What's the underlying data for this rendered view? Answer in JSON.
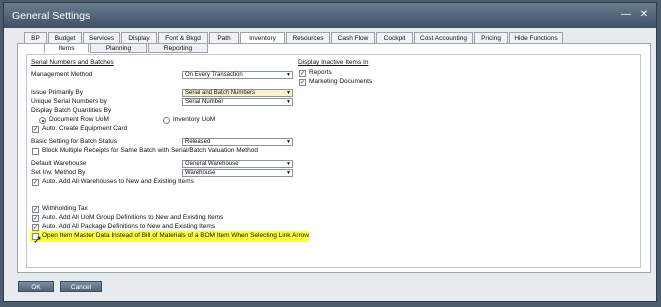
{
  "window": {
    "title": "General Settings",
    "minimize": "—",
    "close": "✕"
  },
  "tabs": [
    {
      "label": "BP"
    },
    {
      "label": "Budget"
    },
    {
      "label": "Services"
    },
    {
      "label": "Display"
    },
    {
      "label": "Font & Bkgd"
    },
    {
      "label": "Path"
    },
    {
      "label": "Inventory"
    },
    {
      "label": "Resources"
    },
    {
      "label": "Cash Flow"
    },
    {
      "label": "Cockpit"
    },
    {
      "label": "Cost Accounting"
    },
    {
      "label": "Pricing"
    },
    {
      "label": "Hide Functions"
    }
  ],
  "active_tab": "Inventory",
  "subtabs": [
    {
      "label": "Items"
    },
    {
      "label": "Planning"
    },
    {
      "label": "Reporting"
    }
  ],
  "form": {
    "serial_section": "Serial Numbers and Batches",
    "mgmt_method_label": "Management Method",
    "mgmt_method_value": "On Every Transaction",
    "issue_primarily_label": "Issue Primarily By",
    "issue_primarily_value": "Serial and Batch Numbers",
    "unique_serial_label": "Unique Serial Numbers by",
    "unique_serial_value": "Serial Number",
    "display_batch_label": "Display Batch Quantities By",
    "radio_doc_row": "Document Row UoM",
    "radio_inventory": "Inventory UoM",
    "auto_create_equipment": "Auto. Create Equipment Card",
    "basic_setting_label": "Basic Setting for Batch Status",
    "basic_setting_value": "Released",
    "block_multiple": "Block Multiple Receipts for Same Batch with Serial/Batch Valuation Method",
    "default_wh_label": "Default Warehouse",
    "default_wh_value": "General Warehouse",
    "set_inv_label": "Set Inv. Method By",
    "set_inv_value": "Warehouse",
    "auto_add_wh": "Auto. Add All Warehouses to New and Existing Items",
    "withholding_tax": "Withholding Tax",
    "auto_add_uom": "Auto. Add All UoM Group Definitions to New and Existing Items",
    "auto_add_package": "Auto. Add All Package Definitions to New and Existing Items",
    "open_item_master": "Open Item Master Data Instead of Bill of Materials of a BOM Item When Selecting Link Arrow",
    "display_inactive_section": "Display Inactive Items In",
    "reports": "Reports",
    "marketing_docs": "Marketing Documents",
    "check": "✓"
  },
  "buttons": {
    "ok": "OK",
    "cancel": "Cancel"
  },
  "colors": {
    "highlight": "#ffff3c",
    "titlebar": "#4f6074"
  }
}
